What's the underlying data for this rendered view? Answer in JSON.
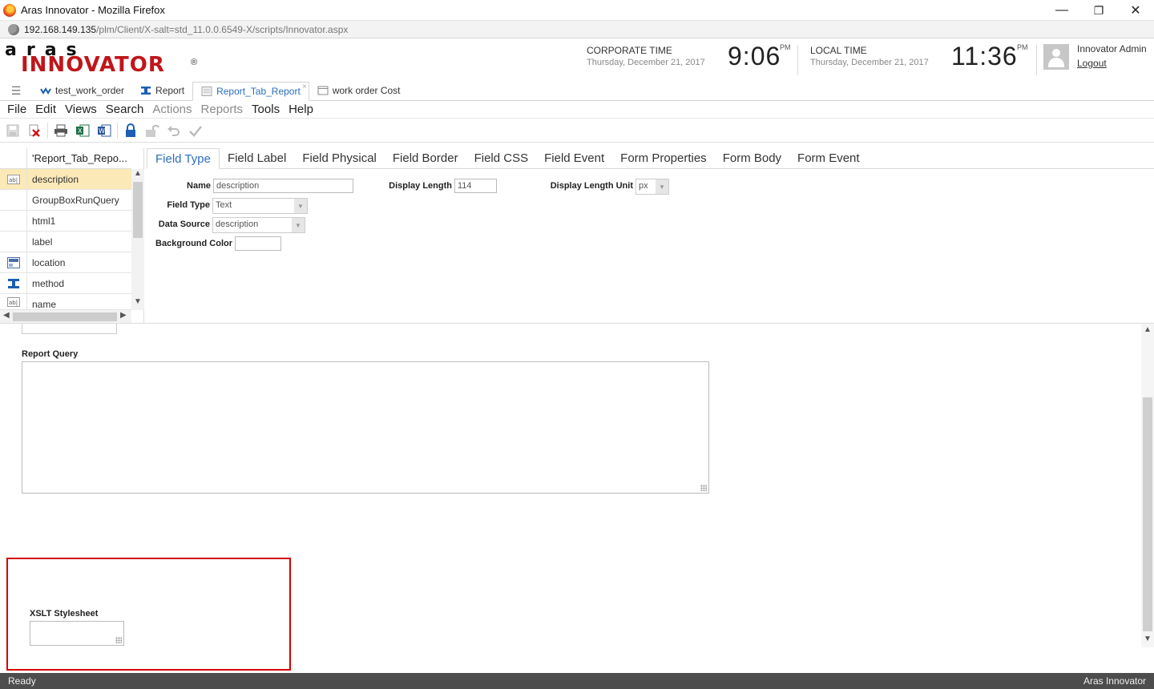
{
  "window": {
    "title": "Aras Innovator - Mozilla Firefox",
    "controls": {
      "minimize": "—",
      "maximize": "❐",
      "close": "✕"
    }
  },
  "urlbar": {
    "host": "192.168.149.135",
    "path": "/plm/Client/X-salt=std_11.0.0.6549-X/scripts/Innovator.aspx"
  },
  "header": {
    "logo_top": "aras",
    "logo_bottom": "INNOVATOR",
    "logo_reg": "®",
    "corporate": {
      "label": "CORPORATE TIME",
      "date": "Thursday, December 21, 2017",
      "time": "9:06",
      "ampm": "PM"
    },
    "local": {
      "label": "LOCAL TIME",
      "date": "Thursday, December 21, 2017",
      "time": "11:36",
      "ampm": "PM"
    },
    "user": "Innovator Admin",
    "logout": "Logout"
  },
  "item_tabs": [
    {
      "label": "test_work_order",
      "icon": "workflow-icon",
      "active": false
    },
    {
      "label": "Report",
      "icon": "report-icon",
      "active": false
    },
    {
      "label": "Report_Tab_Report",
      "icon": "form-icon",
      "active": true
    },
    {
      "label": "work order Cost",
      "icon": "window-icon",
      "active": false
    }
  ],
  "menu": {
    "file": "File",
    "edit": "Edit",
    "views": "Views",
    "search": "Search",
    "actions": "Actions",
    "reports": "Reports",
    "tools": "Tools",
    "help": "Help"
  },
  "grid": {
    "header": "'Report_Tab_Repo...",
    "rows": [
      {
        "label": "description",
        "icon": "text-field-icon",
        "selected": true
      },
      {
        "label": "GroupBoxRunQuery",
        "icon": "",
        "selected": false
      },
      {
        "label": "html1",
        "icon": "",
        "selected": false
      },
      {
        "label": "label",
        "icon": "",
        "selected": false
      },
      {
        "label": "location",
        "icon": "location-field-icon",
        "selected": false
      },
      {
        "label": "method",
        "icon": "method-icon",
        "selected": false
      },
      {
        "label": "name",
        "icon": "text-field-icon",
        "selected": false
      }
    ]
  },
  "property_tabs": {
    "field_type": "Field Type",
    "field_label": "Field Label",
    "field_physical": "Field Physical",
    "field_border": "Field Border",
    "field_css": "Field CSS",
    "field_event": "Field Event",
    "form_properties": "Form Properties",
    "form_body": "Form Body",
    "form_event": "Form Event"
  },
  "field_form": {
    "name_label": "Name",
    "name_value": "description",
    "display_length_label": "Display Length",
    "display_length_value": "114",
    "display_length_unit_label": "Display Length Unit",
    "display_length_unit_value": "px",
    "field_type_label": "Field Type",
    "field_type_value": "Text",
    "data_source_label": "Data Source",
    "data_source_value": "description",
    "background_color_label": "Background Color",
    "background_color_value": ""
  },
  "preview": {
    "report_query_label": "Report Query",
    "xslt_label": "XSLT Stylesheet"
  },
  "status": {
    "left": "Ready",
    "right": "Aras Innovator"
  },
  "colors": {
    "accent": "#2a6ebb",
    "brand_red": "#c0161b",
    "highlight_box": "#d40000",
    "selected_row": "#fbe9b7"
  }
}
